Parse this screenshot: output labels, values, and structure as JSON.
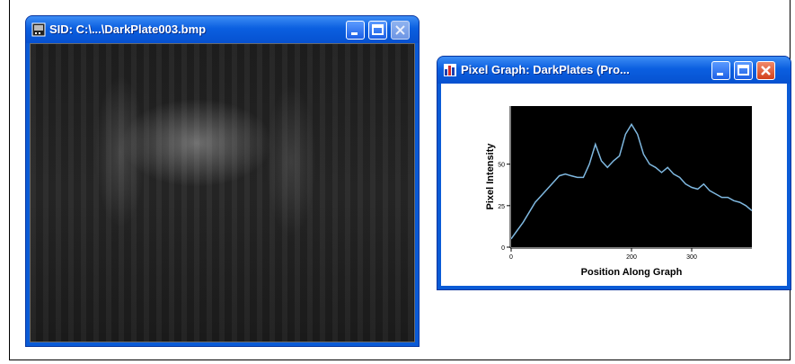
{
  "sid_window": {
    "title": "SID: C:\\...\\DarkPlate003.bmp"
  },
  "graph_window": {
    "title": "Pixel Graph: DarkPlates (Pro..."
  },
  "colors": {
    "titlebar": "#0b5fe0",
    "plot_bg": "#000000",
    "line": "#7fb8e0"
  },
  "icons": {
    "sid_app": "image-file-icon",
    "graph_app": "bar-chart-icon",
    "minimize": "minimize-icon",
    "maximize": "maximize-icon",
    "close": "close-icon"
  },
  "chart_data": {
    "type": "line",
    "xlabel": "Position Along Graph",
    "ylabel": "Pixel Intensity",
    "xlim": [
      0,
      400
    ],
    "ylim": [
      0,
      85
    ],
    "x_ticks": [
      "0",
      "200",
      "300"
    ],
    "y_ticks": [
      "0",
      "25",
      "50"
    ],
    "grid": false,
    "series": [
      {
        "x": [
          0,
          10,
          20,
          30,
          40,
          50,
          60,
          70,
          80,
          90,
          100,
          110,
          120,
          130,
          140,
          150,
          160,
          170,
          180,
          190,
          200,
          210,
          220,
          230,
          240,
          250,
          260,
          270,
          280,
          290,
          300,
          310,
          320,
          330,
          340,
          350,
          360,
          370,
          380,
          390,
          400
        ],
        "y": [
          5,
          10,
          15,
          21,
          27,
          31,
          35,
          39,
          43,
          44,
          43,
          42,
          42,
          50,
          62,
          52,
          48,
          52,
          55,
          68,
          74,
          68,
          56,
          50,
          48,
          45,
          48,
          44,
          42,
          38,
          36,
          35,
          38,
          34,
          32,
          30,
          30,
          28,
          27,
          25,
          22
        ]
      }
    ]
  }
}
